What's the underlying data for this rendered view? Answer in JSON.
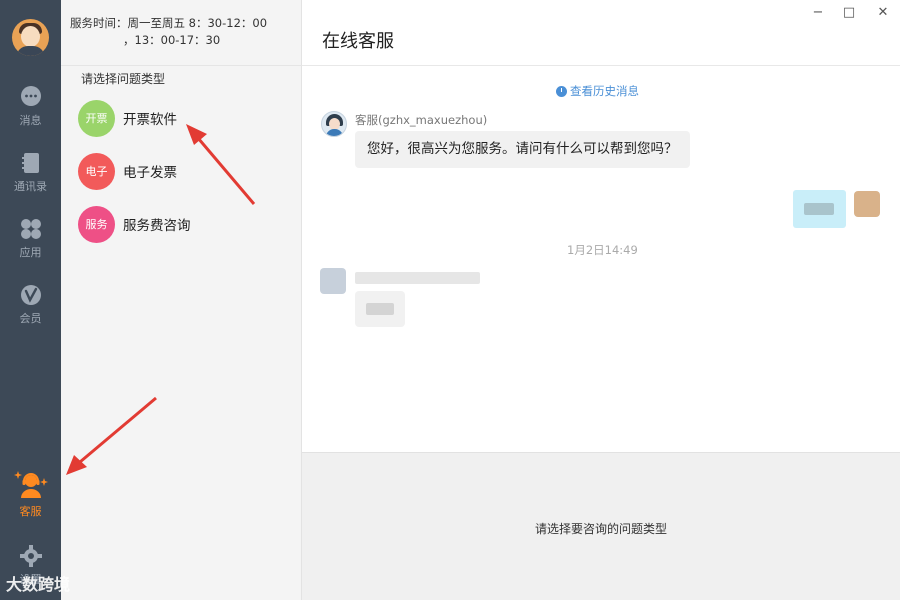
{
  "nav": {
    "items": [
      {
        "label": "消息",
        "icon": "chat-bubble-icon"
      },
      {
        "label": "通讯录",
        "icon": "contacts-book-icon"
      },
      {
        "label": "应用",
        "icon": "apps-grid-icon"
      },
      {
        "label": "会员",
        "icon": "vip-badge-icon"
      },
      {
        "label": "客服",
        "icon": "customer-service-icon"
      },
      {
        "label": "设置",
        "icon": "gear-icon"
      }
    ],
    "active_item": "客服",
    "active_color": "#ff8a20"
  },
  "service_hours": {
    "line1": "服务时间：周一至周五  8：30-12：00",
    "line2": "，13：00-17：30"
  },
  "question_panel": {
    "title": "请选择问题类型",
    "items": [
      {
        "badge": "开票",
        "label": "开票软件",
        "color": "#9ad46a"
      },
      {
        "badge": "电子",
        "label": "电子发票",
        "color": "#f25a5a"
      },
      {
        "badge": "服务",
        "label": "服务费咨询",
        "color": "#ee5086"
      }
    ]
  },
  "chat": {
    "title": "在线客服",
    "history_link": "查看历史消息",
    "agent_name": "客服(gzhx_maxuezhou)",
    "agent_message": "您好，很高兴为您服务。请问有什么可以帮到您吗？",
    "timestamp": "1月2日14:49",
    "input_hint": "请选择要咨询的问题类型"
  },
  "window_controls": {
    "minimize": "−",
    "maximize": "□",
    "close": "✕"
  },
  "watermark": "大数跨境",
  "colors": {
    "nav_bg": "#3d4957",
    "link": "#4a8fd6",
    "annotation_arrow": "#e23b33"
  }
}
